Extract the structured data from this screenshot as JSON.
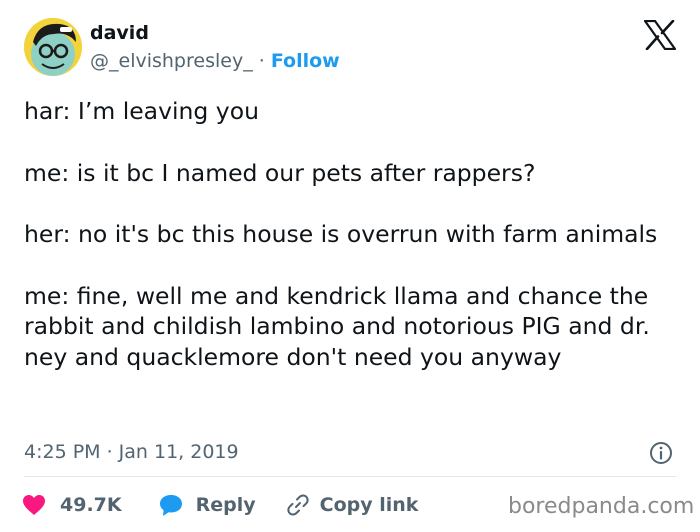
{
  "header": {
    "display_name": "david",
    "handle": "@_elvishpresley_",
    "separator": "·",
    "follow_label": "Follow"
  },
  "tweet": {
    "lines": [
      "har: I’m leaving you",
      "me: is it bc I named our pets after rappers?",
      "her: no it's bc this house is overrun with farm animals",
      "me: fine, well me and kendrick llama and chance the rabbit and childish lambino and notorious PIG and dr. ney and quacklemore don't need you anyway"
    ]
  },
  "meta": {
    "timestamp": "4:25 PM · Jan 11, 2019"
  },
  "actions": {
    "like_count": "49.7K",
    "reply_label": "Reply",
    "copy_link_label": "Copy link"
  },
  "watermark": "boredpanda.com",
  "colors": {
    "follow": "#1d9bf0",
    "like_heart": "#f91880",
    "reply_bubble": "#1d9bf0",
    "secondary_text": "#536471"
  },
  "icons": [
    "avatar",
    "x-logo-icon",
    "info-icon",
    "heart-icon",
    "reply-bubble-icon",
    "link-icon"
  ]
}
